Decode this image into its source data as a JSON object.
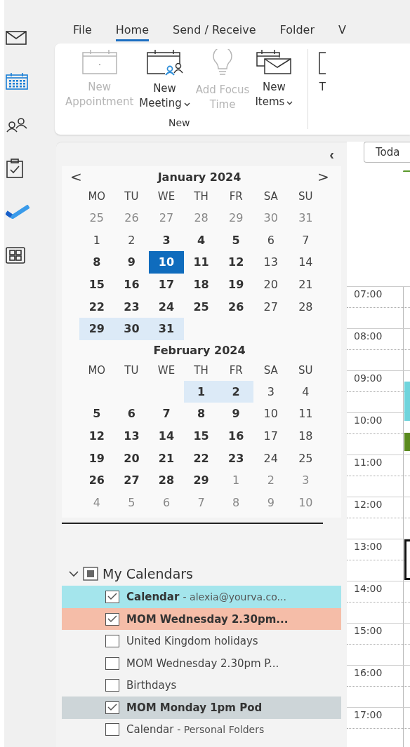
{
  "rail": [
    {
      "kind": "mail",
      "selected": false
    },
    {
      "kind": "calendar",
      "selected": true
    },
    {
      "kind": "people",
      "selected": false
    },
    {
      "kind": "tasks",
      "selected": false
    },
    {
      "kind": "todo",
      "selected": false
    },
    {
      "kind": "apps",
      "selected": false
    }
  ],
  "tabs": [
    {
      "label": "File",
      "selected": false
    },
    {
      "label": "Home",
      "selected": true
    },
    {
      "label": "Send / Receive",
      "selected": false
    },
    {
      "label": "Folder",
      "selected": false
    },
    {
      "label": "V",
      "selected": false
    }
  ],
  "ribbon": {
    "groups": [
      {
        "label": "New",
        "buttons": [
          {
            "kind": "calendar",
            "lines": [
              "New",
              "Appointment"
            ],
            "disabled": true,
            "dropdown": false
          },
          {
            "kind": "meeting",
            "lines": [
              "New",
              "Meeting"
            ],
            "disabled": false,
            "dropdown": true
          },
          {
            "kind": "bulb",
            "lines": [
              "Add Focus",
              "Time"
            ],
            "disabled": true,
            "dropdown": false
          },
          {
            "kind": "items",
            "lines": [
              "New",
              "Items"
            ],
            "disabled": false,
            "dropdown": true
          }
        ]
      },
      {
        "buttons": [
          {
            "kind": "page",
            "lines": [
              "T"
            ],
            "disabled": false,
            "dropdown": false
          }
        ]
      }
    ]
  },
  "collapse_button": "‹",
  "months": [
    {
      "title": "January 2024",
      "prev": "<",
      "next": ">",
      "weekdays": [
        "MO",
        "TU",
        "WE",
        "TH",
        "FR",
        "SA",
        "SU"
      ],
      "weeks": [
        [
          {
            "d": "25",
            "kind": "other"
          },
          {
            "d": "26",
            "kind": "other"
          },
          {
            "d": "27",
            "kind": "other"
          },
          {
            "d": "28",
            "kind": "other"
          },
          {
            "d": "29",
            "kind": "other"
          },
          {
            "d": "30",
            "kind": "other"
          },
          {
            "d": "31",
            "kind": "other"
          }
        ],
        [
          {
            "d": "1",
            "kind": "plain"
          },
          {
            "d": "2",
            "kind": "plain"
          },
          {
            "d": "3",
            "kind": "busy"
          },
          {
            "d": "4",
            "kind": "busy"
          },
          {
            "d": "5",
            "kind": "busy"
          },
          {
            "d": "6",
            "kind": "plain"
          },
          {
            "d": "7",
            "kind": "plain"
          }
        ],
        [
          {
            "d": "8",
            "kind": "busy"
          },
          {
            "d": "9",
            "kind": "busy"
          },
          {
            "d": "10",
            "kind": "selected"
          },
          {
            "d": "11",
            "kind": "busy"
          },
          {
            "d": "12",
            "kind": "busy"
          },
          {
            "d": "13",
            "kind": "plain"
          },
          {
            "d": "14",
            "kind": "plain"
          }
        ],
        [
          {
            "d": "15",
            "kind": "busy"
          },
          {
            "d": "16",
            "kind": "busy"
          },
          {
            "d": "17",
            "kind": "busy"
          },
          {
            "d": "18",
            "kind": "busy"
          },
          {
            "d": "19",
            "kind": "busy"
          },
          {
            "d": "20",
            "kind": "plain"
          },
          {
            "d": "21",
            "kind": "plain"
          }
        ],
        [
          {
            "d": "22",
            "kind": "busy"
          },
          {
            "d": "23",
            "kind": "busy"
          },
          {
            "d": "24",
            "kind": "busy"
          },
          {
            "d": "25",
            "kind": "busy"
          },
          {
            "d": "26",
            "kind": "busy"
          },
          {
            "d": "27",
            "kind": "plain"
          },
          {
            "d": "28",
            "kind": "plain"
          }
        ],
        [
          {
            "d": "29",
            "kind": "range"
          },
          {
            "d": "30",
            "kind": "range"
          },
          {
            "d": "31",
            "kind": "range"
          },
          {
            "kind": "blank"
          },
          {
            "kind": "blank"
          },
          {
            "kind": "blank"
          },
          {
            "kind": "blank"
          }
        ]
      ]
    },
    {
      "title": "February 2024",
      "weekdays": [
        "MO",
        "TU",
        "WE",
        "TH",
        "FR",
        "SA",
        "SU"
      ],
      "weeks": [
        [
          {
            "kind": "blank"
          },
          {
            "kind": "blank"
          },
          {
            "kind": "blank"
          },
          {
            "d": "1",
            "kind": "range"
          },
          {
            "d": "2",
            "kind": "range"
          },
          {
            "d": "3",
            "kind": "plain"
          },
          {
            "d": "4",
            "kind": "plain"
          }
        ],
        [
          {
            "d": "5",
            "kind": "busy"
          },
          {
            "d": "6",
            "kind": "busy"
          },
          {
            "d": "7",
            "kind": "busy"
          },
          {
            "d": "8",
            "kind": "busy"
          },
          {
            "d": "9",
            "kind": "busy"
          },
          {
            "d": "10",
            "kind": "plain"
          },
          {
            "d": "11",
            "kind": "plain"
          }
        ],
        [
          {
            "d": "12",
            "kind": "busy"
          },
          {
            "d": "13",
            "kind": "busy"
          },
          {
            "d": "14",
            "kind": "busy"
          },
          {
            "d": "15",
            "kind": "busy"
          },
          {
            "d": "16",
            "kind": "busy"
          },
          {
            "d": "17",
            "kind": "plain"
          },
          {
            "d": "18",
            "kind": "plain"
          }
        ],
        [
          {
            "d": "19",
            "kind": "busy"
          },
          {
            "d": "20",
            "kind": "busy"
          },
          {
            "d": "21",
            "kind": "busy"
          },
          {
            "d": "22",
            "kind": "busy"
          },
          {
            "d": "23",
            "kind": "busy"
          },
          {
            "d": "24",
            "kind": "plain"
          },
          {
            "d": "25",
            "kind": "plain"
          }
        ],
        [
          {
            "d": "26",
            "kind": "busy"
          },
          {
            "d": "27",
            "kind": "busy"
          },
          {
            "d": "28",
            "kind": "busy"
          },
          {
            "d": "29",
            "kind": "busy"
          },
          {
            "d": "1",
            "kind": "other"
          },
          {
            "d": "2",
            "kind": "other"
          },
          {
            "d": "3",
            "kind": "other"
          }
        ],
        [
          {
            "d": "4",
            "kind": "other"
          },
          {
            "d": "5",
            "kind": "other"
          },
          {
            "d": "6",
            "kind": "other"
          },
          {
            "d": "7",
            "kind": "other"
          },
          {
            "d": "8",
            "kind": "other"
          },
          {
            "d": "9",
            "kind": "other"
          },
          {
            "d": "10",
            "kind": "other"
          }
        ]
      ]
    }
  ],
  "calendar_group": {
    "label": "My Calendars",
    "expanded": true,
    "items": [
      {
        "name": "Calendar",
        "detail": "- alexia@yourva.co...",
        "checked": true,
        "color": "#a4e5ec"
      },
      {
        "name": "MOM Wednesday 2.30pm...",
        "checked": true,
        "color": "#f5bda8"
      },
      {
        "name": "United Kingdom holidays",
        "checked": false
      },
      {
        "name": "MOM Wednesday 2.30pm P...",
        "checked": false
      },
      {
        "name": "Birthdays",
        "checked": false
      },
      {
        "name": "MOM Monday 1pm Pod",
        "checked": true,
        "color": "#cdd5d8"
      },
      {
        "name": "Calendar",
        "detail": "- Personal Folders",
        "checked": false
      }
    ]
  },
  "day_view": {
    "today_button": "Toda",
    "hours": [
      {
        "label": "07:00"
      },
      {
        "label": "08:00"
      },
      {
        "label": "09:00",
        "event": {
          "kind": "filled",
          "color": "#6fd4dc"
        }
      },
      {
        "label": "10:00",
        "event": {
          "kind": "filled",
          "color": "#5a8a1e"
        }
      },
      {
        "label": "11:00"
      },
      {
        "label": "12:00"
      },
      {
        "label": "13:00",
        "event": {
          "kind": "outlined",
          "color": "#111111"
        }
      },
      {
        "label": "14:00"
      },
      {
        "label": "15:00"
      },
      {
        "label": "16:00"
      },
      {
        "label": "17:00"
      }
    ]
  }
}
